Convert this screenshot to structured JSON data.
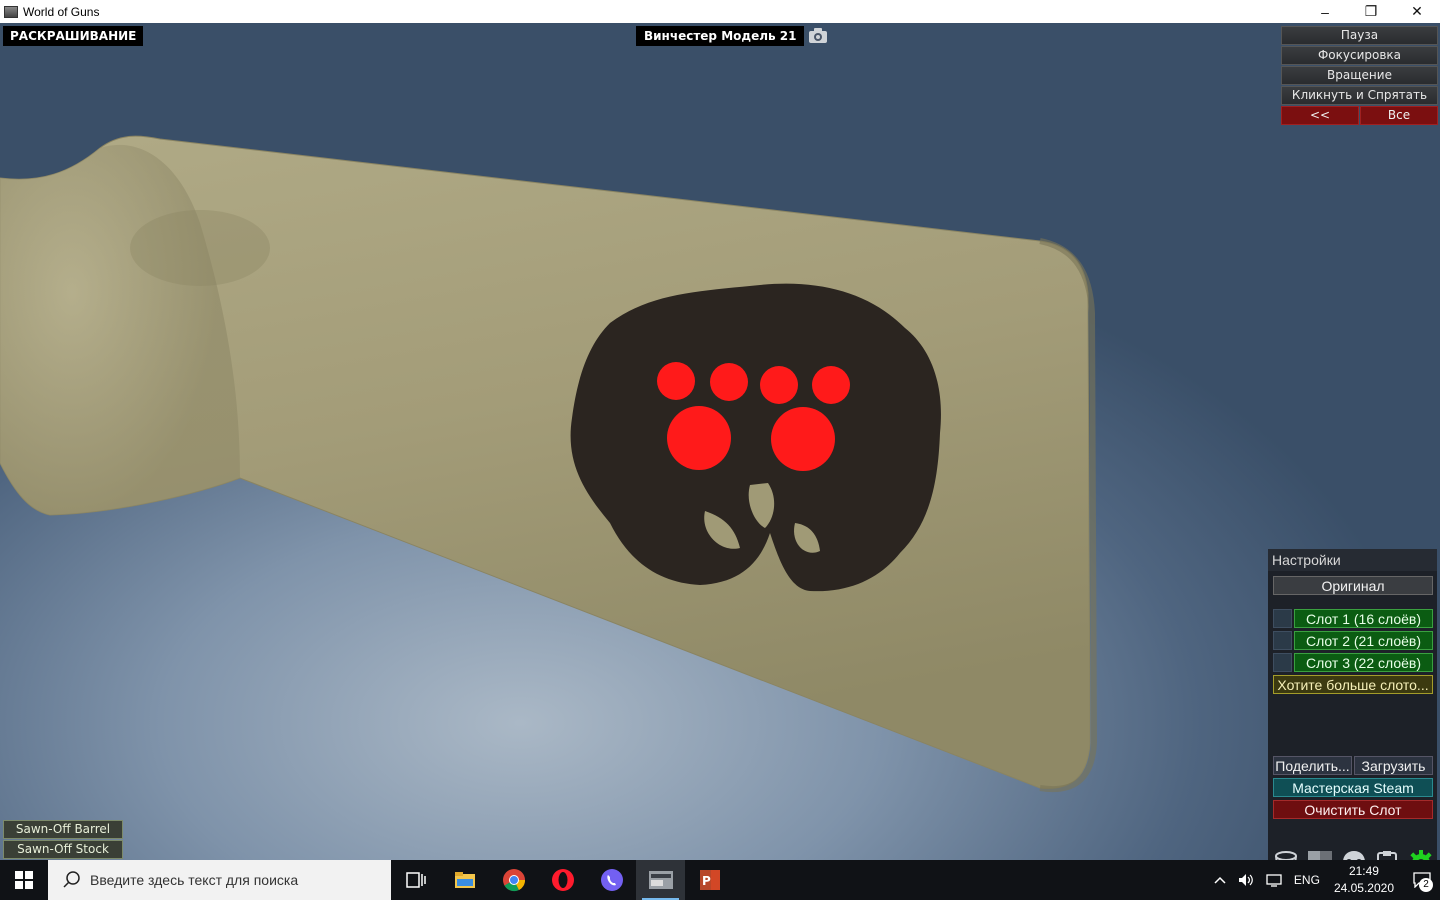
{
  "window": {
    "title": "World of Guns",
    "icon": "app-icon",
    "controls": {
      "minimize": "–",
      "restore": "❐",
      "close": "✕"
    }
  },
  "viewport": {
    "mode_label": "РАСКРАШИВАНИЕ",
    "model_title": "Винчестер Модель 21",
    "camera_icon": "camera-icon",
    "colors": {
      "stock": "#a09a76",
      "decal": "#2b2520",
      "eyes": "#ff1a1a",
      "background": "#4f6580"
    }
  },
  "top_menu": {
    "pause": "Пауза",
    "focus": "Фокусировка",
    "rotate": "Вращение",
    "click_hide": "Кликнуть и Спрятать",
    "back": "<<",
    "all": "Все"
  },
  "settings": {
    "title": "Настройки",
    "original": "Оригинал",
    "slots": [
      {
        "label": "Слот 1 (16 слоёв)"
      },
      {
        "label": "Слот 2 (21 слоёв)"
      },
      {
        "label": "Слот 3 (22 слоёв)"
      }
    ],
    "more_slots": "Хотите больше слото...",
    "share": "Поделить...",
    "load": "Загрузить",
    "steam": "Мастерская Steam",
    "clear": "Очистить Слот",
    "tools": [
      "bucket-icon",
      "texture-icon",
      "skull-icon",
      "clipboard-icon",
      "gear-icon"
    ]
  },
  "parts": [
    {
      "label": "Sawn-Off Barrel"
    },
    {
      "label": "Sawn-Off Stock"
    }
  ],
  "taskbar": {
    "search_placeholder": "Введите здесь текст для поиска",
    "apps": [
      "task-view-icon",
      "file-explorer-icon",
      "chrome-icon",
      "opera-icon",
      "viber-icon",
      "world-of-guns-icon",
      "powerpoint-icon"
    ],
    "language": "ENG",
    "time": "21:49",
    "date": "24.05.2020",
    "notifications": "2"
  }
}
